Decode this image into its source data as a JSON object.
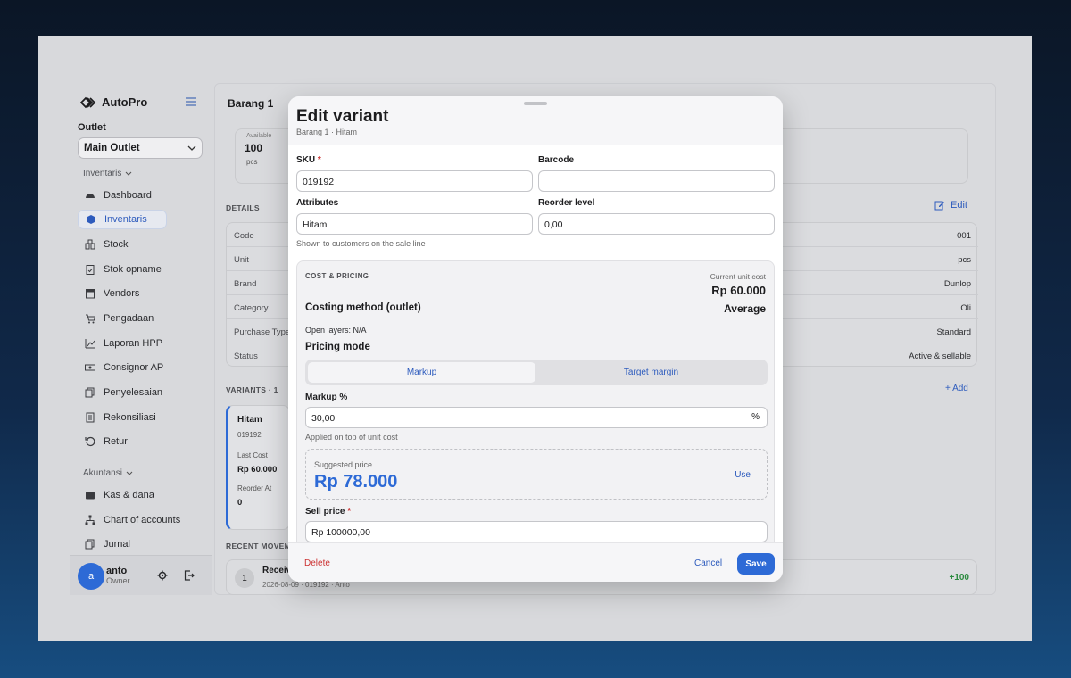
{
  "sidebar": {
    "brand": "AutoPro",
    "outlet_label": "Outlet",
    "outlet_value": "Main Outlet",
    "group_inventaris": "Inventaris",
    "group_akuntansi": "Akuntansi",
    "items": [
      {
        "label": "Dashboard",
        "icon": "dashboard-icon"
      },
      {
        "label": "Inventaris",
        "icon": "box-icon",
        "active": true
      },
      {
        "label": "Stock",
        "icon": "stock-icon"
      },
      {
        "label": "Stok opname",
        "icon": "clipboard-check-icon"
      },
      {
        "label": "Vendors",
        "icon": "store-icon"
      },
      {
        "label": "Pengadaan",
        "icon": "cart-icon"
      },
      {
        "label": "Laporan HPP",
        "icon": "chart-icon"
      },
      {
        "label": "Consignor AP",
        "icon": "money-icon"
      },
      {
        "label": "Penyelesaian",
        "icon": "documents-icon"
      },
      {
        "label": "Rekonsiliasi",
        "icon": "list-doc-icon"
      },
      {
        "label": "Retur",
        "icon": "return-icon"
      }
    ],
    "acct_items": [
      {
        "label": "Kas & dana",
        "icon": "wallet-icon"
      },
      {
        "label": "Chart of accounts",
        "icon": "hierarchy-icon"
      },
      {
        "label": "Jurnal",
        "icon": "journal-icon"
      }
    ],
    "user": {
      "initial": "a",
      "name": "anto",
      "role": "Owner"
    }
  },
  "main": {
    "title": "Barang 1",
    "available_label": "Available",
    "available_value": "100",
    "available_unit": "pcs",
    "details_label": "DETAILS",
    "edit_label": "Edit",
    "details": [
      {
        "k": "Code",
        "v": "001"
      },
      {
        "k": "Unit",
        "v": "pcs"
      },
      {
        "k": "Brand",
        "v": "Dunlop"
      },
      {
        "k": "Category",
        "v": "Oli"
      },
      {
        "k": "Purchase Type",
        "v": "Standard"
      },
      {
        "k": "Status",
        "v": "Active & sellable"
      }
    ],
    "variants_label": "VARIANTS · 1",
    "add_label": "+ Add",
    "variant": {
      "name": "Hitam",
      "sku": "019192",
      "last_cost_label": "Last Cost",
      "last_cost": "Rp 60.000",
      "reorder_label": "Reorder At",
      "reorder": "0"
    },
    "recent_label": "RECENT MOVEME",
    "movement": {
      "num": "1",
      "title": "Receiv",
      "sub": "2026-08-09 · 019192 · Anto",
      "qty": "+100"
    }
  },
  "modal": {
    "title": "Edit variant",
    "subtitle": "Barang 1 · Hitam",
    "sku_label": "SKU",
    "sku_value": "019192",
    "barcode_label": "Barcode",
    "barcode_value": "",
    "attributes_label": "Attributes",
    "attributes_value": "Hitam",
    "attributes_hint": "Shown to customers on the sale line",
    "reorder_label": "Reorder level",
    "reorder_value": "0,00",
    "cost": {
      "title": "COST & PRICING",
      "current_cost_label": "Current unit cost",
      "current_cost": "Rp 60.000",
      "costing_method_label": "Costing method (outlet)",
      "costing_method": "Average",
      "open_layers": "Open layers: N/A",
      "pricing_mode_label": "Pricing mode",
      "mode_markup": "Markup",
      "mode_target": "Target margin",
      "markup_label": "Markup %",
      "markup_value": "30,00",
      "markup_unit": "%",
      "markup_hint": "Applied on top of unit cost",
      "suggested_label": "Suggested price",
      "suggested_value": "Rp 78.000",
      "use_label": "Use",
      "sell_label": "Sell price",
      "sell_value": "Rp  100000,00"
    },
    "delete_label": "Delete",
    "cancel_label": "Cancel",
    "save_label": "Save"
  },
  "colors": {
    "accent": "#2d6ad6",
    "danger": "#cc3333",
    "positive": "#2a8a3e"
  }
}
